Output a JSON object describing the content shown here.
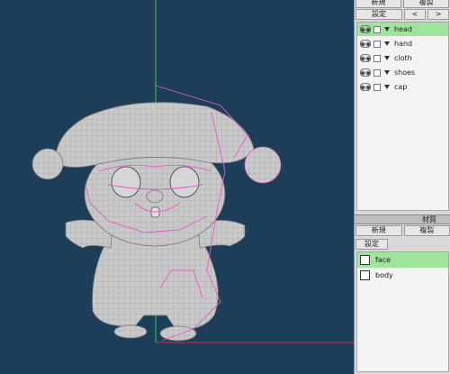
{
  "object_panel": {
    "buttons_top": [
      "新規",
      "複製"
    ],
    "settings_label": "設定",
    "prev_label": "<",
    "next_label": ">",
    "objects": [
      {
        "name": "head",
        "selected": true
      },
      {
        "name": "hand",
        "selected": false
      },
      {
        "name": "cloth",
        "selected": false
      },
      {
        "name": "shoes",
        "selected": false
      },
      {
        "name": "cap",
        "selected": false
      }
    ],
    "visibility_glyph": "◉◉"
  },
  "material_panel": {
    "header": "材質",
    "new_label": "新規",
    "copy_label": "複製",
    "settings_label": "設定",
    "materials": [
      {
        "name": "face",
        "selected": true
      },
      {
        "name": "body",
        "selected": false
      }
    ]
  },
  "colors": {
    "viewport_bg": "#1c3e59",
    "selection": "#9ee49a",
    "wire_highlight": "#e85bc9",
    "axis_green": "#3ccf4e",
    "axis_red": "#d8284a"
  }
}
